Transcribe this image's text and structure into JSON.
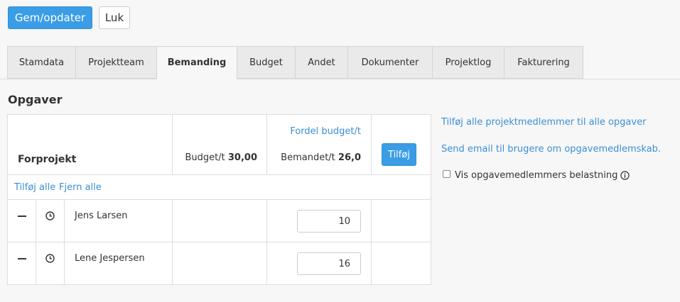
{
  "toolbar": {
    "save_label": "Gem/opdater",
    "close_label": "Luk"
  },
  "tabs": [
    {
      "label": "Stamdata",
      "active": false
    },
    {
      "label": "Projektteam",
      "active": false
    },
    {
      "label": "Bemanding",
      "active": true
    },
    {
      "label": "Budget",
      "active": false
    },
    {
      "label": "Andet",
      "active": false
    },
    {
      "label": "Dokumenter",
      "active": false
    },
    {
      "label": "Projektlog",
      "active": false
    },
    {
      "label": "Fakturering",
      "active": false
    }
  ],
  "section_title": "Opgaver",
  "task": {
    "name": "Forprojekt",
    "budget_label": "Budget/t",
    "budget_value": "30,00",
    "fordel_link": "Fordel budget/t",
    "bemandet_label": "Bemandet/t",
    "bemandet_value": "26,0",
    "add_button": "Tilføj",
    "add_all": "Tilføj alle",
    "remove_all": "Fjern alle"
  },
  "members": [
    {
      "name": "Jens Larsen",
      "hours": "10"
    },
    {
      "name": "Lene Jespersen",
      "hours": "16"
    }
  ],
  "side": {
    "add_all_members": "Tilføj alle projektmedlemmer til alle opgaver",
    "send_email": "Send email til brugere om opgavemedlemskab.",
    "show_load_label": "Vis opgavemedlemmers belastning",
    "show_load_checked": false
  },
  "icons": {
    "remove": "minus-icon",
    "clock": "clock-icon",
    "info": "info-icon"
  },
  "colors": {
    "accent": "#3a9de6",
    "link": "#3a8fd6"
  }
}
